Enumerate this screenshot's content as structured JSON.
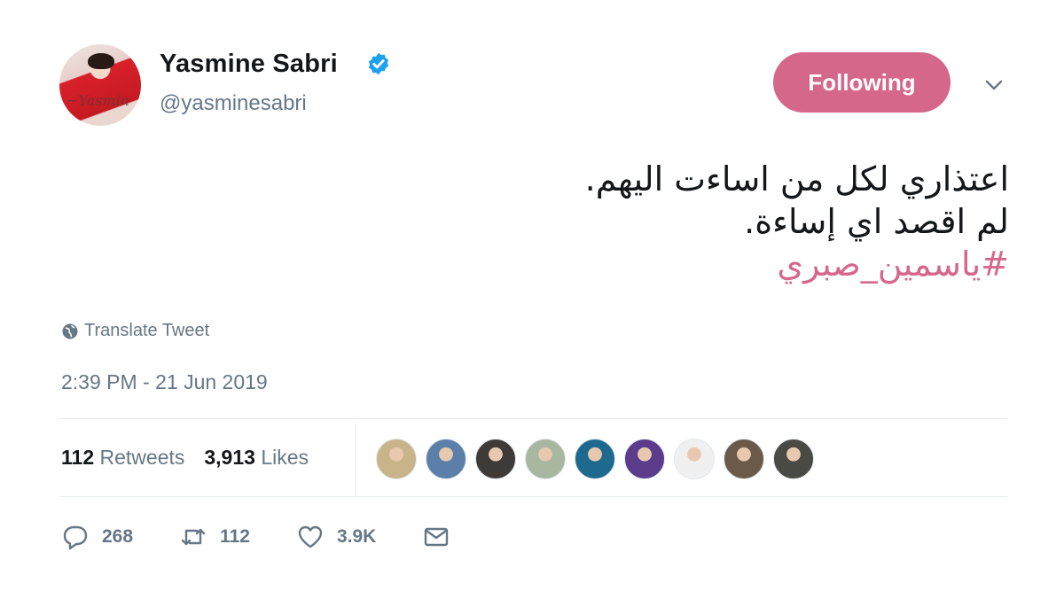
{
  "author": {
    "name": "Yasmine Sabri",
    "handle": "@yasminesabri",
    "avatar_icon": "profile-photo",
    "verified_icon": "verified-badge-icon",
    "verified_color": "#1da1f2"
  },
  "follow_button": {
    "label": "Following",
    "color": "#d5678b"
  },
  "tweet": {
    "lines": [
      "اعتذاري لكل من اساءت اليهم.",
      "لم اقصد اي إساءة."
    ],
    "hashtag": "#ياسمين_صبري"
  },
  "translate_label": "Translate Tweet",
  "timestamp": "2:39 PM - 21 Jun 2019",
  "stats": {
    "retweets_count": "112",
    "retweets_label": "Retweets",
    "likes_count": "3,913",
    "likes_label": "Likes"
  },
  "liker_avatars": [
    {
      "name": "liker-avatar-1",
      "color": "#c9b48a"
    },
    {
      "name": "liker-avatar-2",
      "color": "#5b7fa8"
    },
    {
      "name": "liker-avatar-3",
      "color": "#3e3a38"
    },
    {
      "name": "liker-avatar-4",
      "color": "#a8b7a0"
    },
    {
      "name": "liker-avatar-5",
      "color": "#1e6a8f"
    },
    {
      "name": "liker-avatar-6",
      "color": "#5a3b8c"
    },
    {
      "name": "liker-avatar-7",
      "color": "#f0f0f0"
    },
    {
      "name": "liker-avatar-8",
      "color": "#6b5a4a"
    },
    {
      "name": "liker-avatar-9",
      "color": "#4a4a44"
    }
  ],
  "actions": {
    "reply_count": "268",
    "retweet_count": "112",
    "like_count": "3.9K",
    "reply_icon": "reply-icon",
    "retweet_icon": "retweet-icon",
    "like_icon": "heart-icon",
    "message_icon": "envelope-icon"
  }
}
